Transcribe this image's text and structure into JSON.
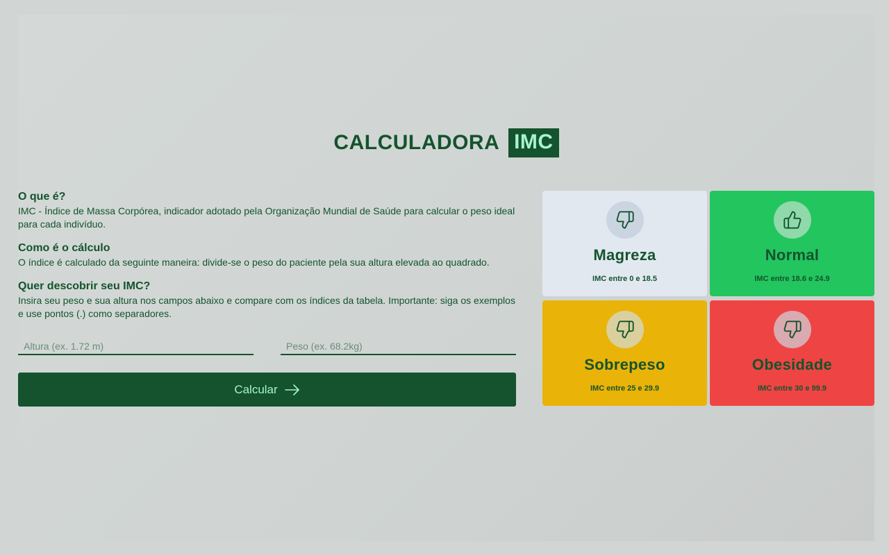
{
  "header": {
    "title_main": "CALCULADORA",
    "title_badge": "IMC"
  },
  "info": {
    "what_title": "O que é?",
    "what_text": "IMC - Índice de Massa Corpórea, indicador adotado pela Organização Mundial de Saúde para calcular o peso ideal para cada indivíduo.",
    "calc_title": "Como é o cálculo",
    "calc_text": "O índice é calculado da seguinte maneira: divide-se o peso do paciente pela sua altura elevada ao quadrado.",
    "discover_title": "Quer descobrir seu IMC?",
    "discover_text": "Insira seu peso e sua altura nos campos abaixo e compare com os índices da tabela. Importante: siga os exemplos e use pontos (.) como separadores."
  },
  "form": {
    "height_placeholder": "Altura (ex. 1.72 m)",
    "height_value": "",
    "weight_placeholder": "Peso (ex. 68.2kg)",
    "weight_value": "",
    "submit_label": "Calcular",
    "submit_icon": "arrow-right-icon"
  },
  "cards": [
    {
      "title": "Magreza",
      "range": "IMC entre 0 e 18.5",
      "icon": "thumbs-down-icon",
      "color": "#e2e8f0"
    },
    {
      "title": "Normal",
      "range": "IMC entre 18.6 e 24.9",
      "icon": "thumbs-up-icon",
      "color": "#22c55e"
    },
    {
      "title": "Sobrepeso",
      "range": "IMC entre 25 e 29.9",
      "icon": "thumbs-down-icon",
      "color": "#eab308"
    },
    {
      "title": "Obesidade",
      "range": "IMC entre 30 e 99.9",
      "icon": "thumbs-down-icon",
      "color": "#ef4444"
    }
  ],
  "colors": {
    "primary": "#14532d",
    "accent_text": "#a7f3d0",
    "background": "#d1d6d4"
  }
}
